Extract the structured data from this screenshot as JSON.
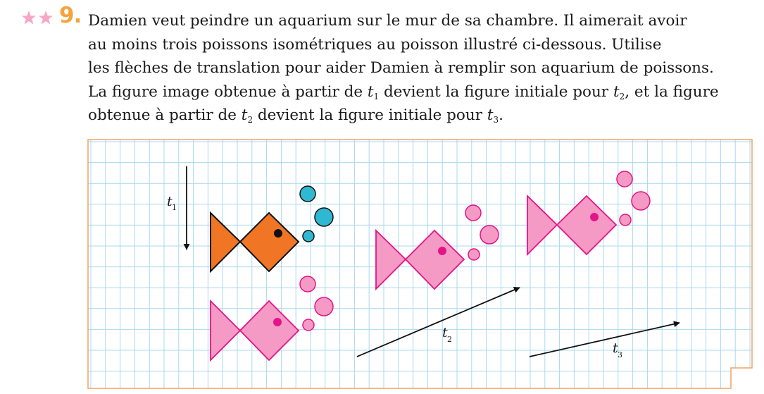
{
  "exercise": {
    "number": "9.",
    "difficulty_stars": 2,
    "lines": [
      [
        "Damien veut peindre un aquarium sur le mur de sa chambre. Il aimerait avoir"
      ],
      [
        "au moins trois poissons isométriques au poisson illustré ci-dessous. Utilise"
      ],
      [
        "les flèches de translation pour aider Damien à remplir son aquarium de poissons."
      ],
      [
        "La figure image obtenue à partir de ",
        {
          "v": "t",
          "s": "1"
        },
        " devient la figure initiale pour ",
        {
          "v": "t",
          "s": "2"
        },
        ", et la figure"
      ],
      [
        "obtenue à partir de ",
        {
          "v": "t",
          "s": "2"
        },
        " devient la figure initiale pour ",
        {
          "v": "t",
          "s": "3"
        },
        "."
      ]
    ]
  },
  "figure": {
    "colors": {
      "original_fish": "#f07524",
      "original_bubbles": "#2fb8d2",
      "image_fish": "#f49ac4",
      "image_stroke": "#e4138a",
      "grid_line": "#a9d8ef",
      "border": "#f2a463",
      "star": "#f7a6c6",
      "number": "#f5a33c"
    },
    "labels": {
      "t1": {
        "var": "t",
        "sub": "1"
      },
      "t2": {
        "var": "t",
        "sub": "2"
      },
      "t3": {
        "var": "t",
        "sub": "3"
      }
    }
  }
}
